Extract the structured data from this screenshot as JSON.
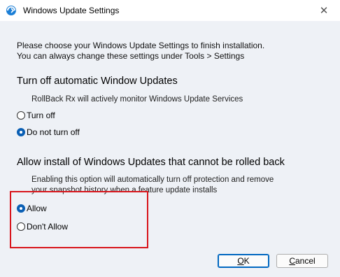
{
  "window": {
    "title": "Windows Update Settings",
    "close_glyph": "✕"
  },
  "intro": {
    "line1": "Please choose your Windows Update Settings to finish installation.",
    "line2": "You can always change these settings under Tools > Settings"
  },
  "section1": {
    "title": "Turn off automatic Window Updates",
    "description": "RollBack Rx will actively monitor Windows Update Services",
    "options": [
      {
        "label": "Turn off",
        "checked": false
      },
      {
        "label": "Do not turn off",
        "checked": true
      }
    ]
  },
  "section2": {
    "title": "Allow install of Windows Updates that cannot be rolled back",
    "description_line1": "Enabling this option will automatically turn off protection and remove",
    "description_line2": "your snapshot history when a feature update installs",
    "options": [
      {
        "label": "Allow",
        "checked": true
      },
      {
        "label": "Don't Allow",
        "checked": false
      }
    ]
  },
  "buttons": {
    "ok_label": "OK",
    "ok_accel": "O",
    "ok_rest": "K",
    "cancel_label": "Cancel",
    "cancel_accel": "C",
    "cancel_rest": "ancel"
  },
  "colors": {
    "highlight": "#d8141b",
    "accent": "#0a5fb4"
  }
}
